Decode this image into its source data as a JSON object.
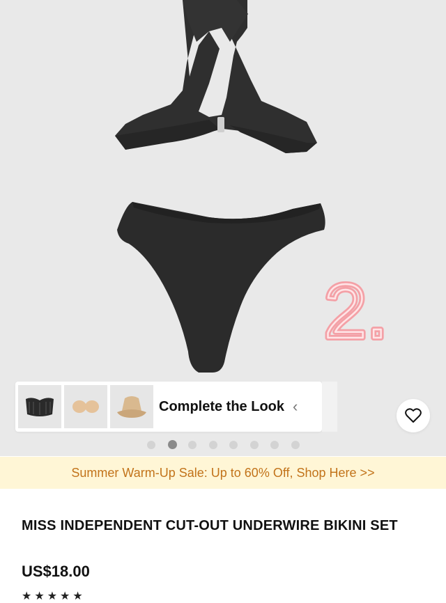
{
  "product": {
    "title": "MISS INDEPENDENT CUT-OUT UNDERWIRE BIKINI SET",
    "price": "US$18.00",
    "rating_stars": "★★★★★"
  },
  "sticker": {
    "text": "2."
  },
  "complete_look": {
    "label": "Complete the Look",
    "chevron": "‹",
    "thumbnails": [
      {
        "name": "corset-top",
        "icon": "corset-icon"
      },
      {
        "name": "nipple-covers",
        "icon": "nipple-cover-icon"
      },
      {
        "name": "bucket-hat",
        "icon": "bucket-hat-icon"
      }
    ]
  },
  "carousel": {
    "count": 8,
    "active_index": 1
  },
  "banner": {
    "text": "Summer Warm-Up Sale: Up to 60% Off, Shop Here >>"
  },
  "colors": {
    "hero_bg": "#e9e9e9",
    "banner_bg": "#fff6d6",
    "banner_text": "#c2731a",
    "sticker_pink": "#f4a0a6"
  },
  "icons": {
    "wishlist": "heart-outline-icon"
  }
}
